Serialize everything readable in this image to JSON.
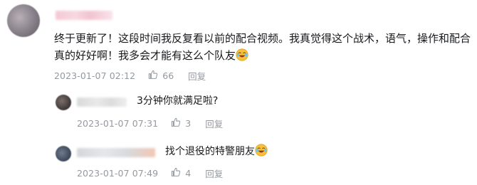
{
  "comment": {
    "text_line1": "终于更新了！这段时间我反复看以前的配合视频。我真觉得这个战术，语气，操作和配合",
    "text_line2": "真的好好啊！我多会才能有这么个队友",
    "emoji": "laughing-tears-emoji",
    "timestamp": "2023-01-07 02:12",
    "like_count": "66",
    "reply_label": "回复"
  },
  "replies": [
    {
      "text": "3分钟你就满足啦?",
      "timestamp": "2023-01-07 07:31",
      "like_count": "3",
      "reply_label": "回复"
    },
    {
      "text": "找个退役的特警朋友",
      "emoji": "laughing-tears-emoji",
      "timestamp": "2023-01-07 07:49",
      "like_count": "4",
      "reply_label": "回复"
    }
  ],
  "colors": {
    "text": "#18191c",
    "meta": "#9499a0",
    "emoji_face": "#f7c23a"
  }
}
